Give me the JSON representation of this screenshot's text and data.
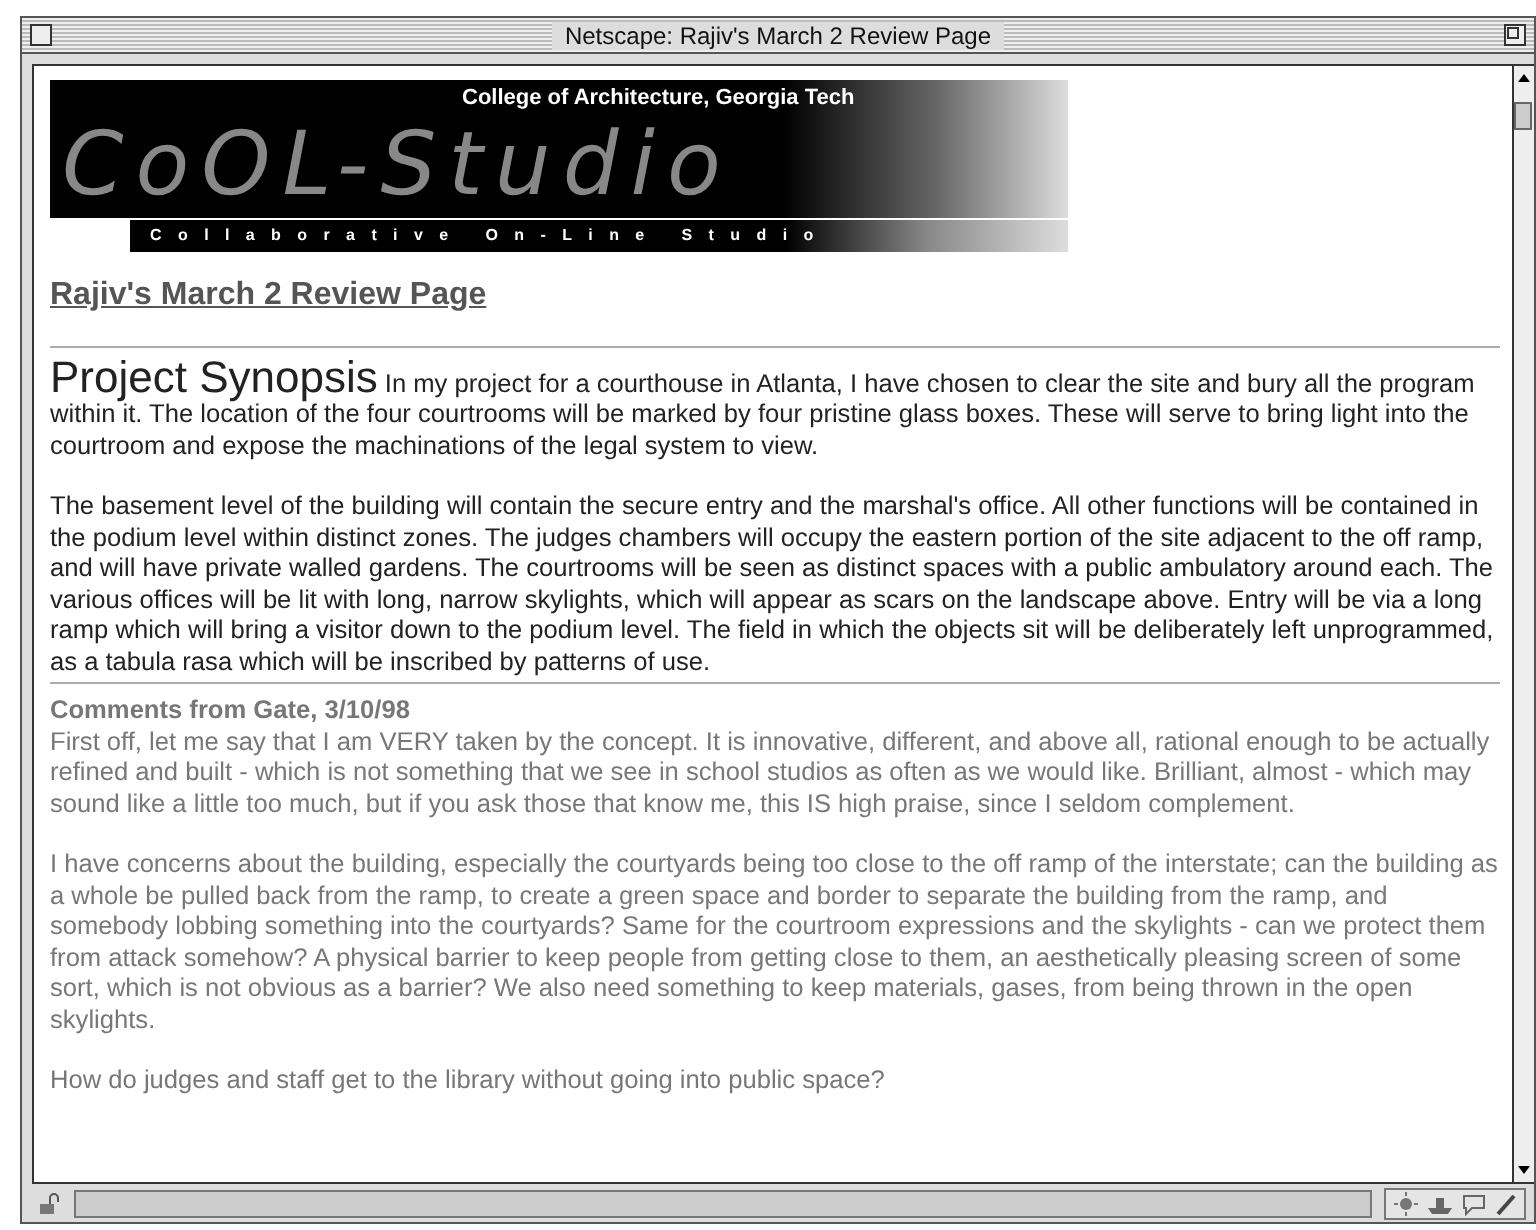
{
  "window": {
    "title": "Netscape: Rajiv's March 2 Review Page"
  },
  "banner": {
    "institution": "College of Architecture, Georgia Tech",
    "logo": "CoOL-Studio",
    "tagline": "Collaborative On-Line Studio"
  },
  "page_title": "Rajiv's March 2 Review Page",
  "synopsis": {
    "heading": "Project Synopsis",
    "paragraphs": [
      "In my project for a courthouse in Atlanta, I have chosen to clear the site and bury all the program within it. The location of the four courtrooms will be marked by four pristine glass boxes. These will serve to bring light into the courtroom and expose the machinations of the legal system to view.",
      "The basement level of the building will contain the secure entry and the marshal's office. All other functions will be contained in the podium level within distinct zones. The judges chambers will occupy the eastern portion of the site adjacent to the off ramp, and will have private walled gardens. The courtrooms will be seen as distinct spaces with a public ambulatory around each. The various offices will be lit with long, narrow skylights, which will appear as scars on the landscape above. Entry will be via a long ramp which will bring a visitor down to the podium level. The field in which the objects sit will be deliberately left unprogrammed, as a tabula rasa which will be inscribed by patterns of use."
    ]
  },
  "comments": {
    "heading": "Comments from Gate, 3/10/98",
    "paragraphs": [
      "First off, let me say that I am VERY taken by the concept. It is innovative, different, and above all, rational enough to be actually refined and built - which is not something that we see in school studios as often as we would like. Brilliant, almost - which may sound like a little too much, but if you ask those that know me, this IS high praise, since I seldom complement.",
      "I have concerns about the building, especially the courtyards being too close to the off ramp of the interstate; can the building as a whole be pulled back from the ramp, to create a green space and border to separate the building from the ramp, and somebody lobbing something into the courtyards? Same for the courtroom expressions and the skylights - can we protect them from attack somehow? A physical barrier to keep people from getting close to them, an aesthetically pleasing screen of some sort, which is not obvious as a barrier? We also need something to keep materials, gases, from being thrown in the open skylights.",
      "How do judges and staff get to the library without going into public space?"
    ]
  }
}
